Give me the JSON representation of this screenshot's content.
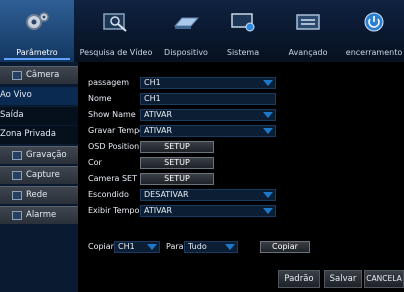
{
  "menu": [
    {
      "label": "Parâmetro",
      "icon": "gear-icon"
    },
    {
      "label": "Pesquisa de Vídeo",
      "icon": "video-search-icon"
    },
    {
      "label": "Dispositivo",
      "icon": "hard-drive-icon"
    },
    {
      "label": "Sistema",
      "icon": "monitor-icon"
    },
    {
      "label": "Avançado",
      "icon": "advanced-icon"
    },
    {
      "label": "encerramento",
      "icon": "power-icon"
    }
  ],
  "sidebar": [
    {
      "label": "Câmera",
      "icon": "camera-icon"
    },
    {
      "label": "Ao Vivo"
    },
    {
      "label": "Saída"
    },
    {
      "label": "Zona Privada"
    },
    {
      "label": "Gravação",
      "icon": "record-icon"
    },
    {
      "label": "Capture",
      "icon": "capture-icon"
    },
    {
      "label": "Rede",
      "icon": "network-icon"
    },
    {
      "label": "Alarme",
      "icon": "alarm-icon"
    }
  ],
  "form": {
    "passagem_label": "passagem",
    "passagem_value": "CH1",
    "nome_label": "Nome",
    "nome_value": "CH1",
    "showname_label": "Show Name",
    "showname_value": "ATIVAR",
    "gravar_label": "Gravar Tempo",
    "gravar_value": "ATIVAR",
    "osd_label": "OSD Position",
    "osd_button": "SETUP",
    "cor_label": "Cor",
    "cor_button": "SETUP",
    "camset_label": "Camera SET",
    "camset_button": "SETUP",
    "escondido_label": "Escondido",
    "escondido_value": "DESATIVAR",
    "exibir_label": "Exibir Tempo",
    "exibir_value": "ATIVAR"
  },
  "copy": {
    "label": "Copiar",
    "from": "CH1",
    "para_label": "Para",
    "to": "Tudo",
    "button": "Copiar"
  },
  "bottom": {
    "padrao": "Padrão",
    "salvar": "Salvar",
    "cancelar": "CANCELA"
  },
  "colors": {
    "accent": "#1e78c8",
    "active_tab": "#2f5f95"
  }
}
